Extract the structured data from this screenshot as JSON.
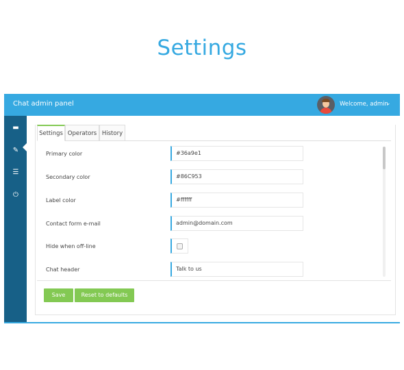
{
  "page": {
    "title": "Settings"
  },
  "header": {
    "brand": "Chat admin panel",
    "welcome": "Welcome, admin",
    "caret_icon": "chevron-down-icon",
    "accent_color": "#36a9e1"
  },
  "sidebar": {
    "items": [
      {
        "name": "chat-icon",
        "glyph": "▬",
        "active": false
      },
      {
        "name": "wrench-icon",
        "glyph": "✎",
        "active": true
      },
      {
        "name": "list-icon",
        "glyph": "☰",
        "active": false
      },
      {
        "name": "power-icon",
        "glyph": "⏻",
        "active": false
      }
    ]
  },
  "tabs": [
    {
      "label": "Settings",
      "active": true
    },
    {
      "label": "Operators",
      "active": false
    },
    {
      "label": "History",
      "active": false
    }
  ],
  "settings": {
    "primary_color": {
      "label": "Primary color",
      "value": "#36a9e1"
    },
    "secondary_color": {
      "label": "Secondary color",
      "value": "#86C953"
    },
    "label_color": {
      "label": "Label color",
      "value": "#ffffff"
    },
    "contact_email": {
      "label": "Contact form e-mail",
      "value": "admin@domain.com"
    },
    "hide_offline": {
      "label": "Hide when off-line",
      "checked": false
    },
    "chat_header": {
      "label": "Chat header",
      "value": "Talk to us"
    }
  },
  "buttons": {
    "save": "Save",
    "reset": "Reset to defaults",
    "color": "#83c953"
  }
}
